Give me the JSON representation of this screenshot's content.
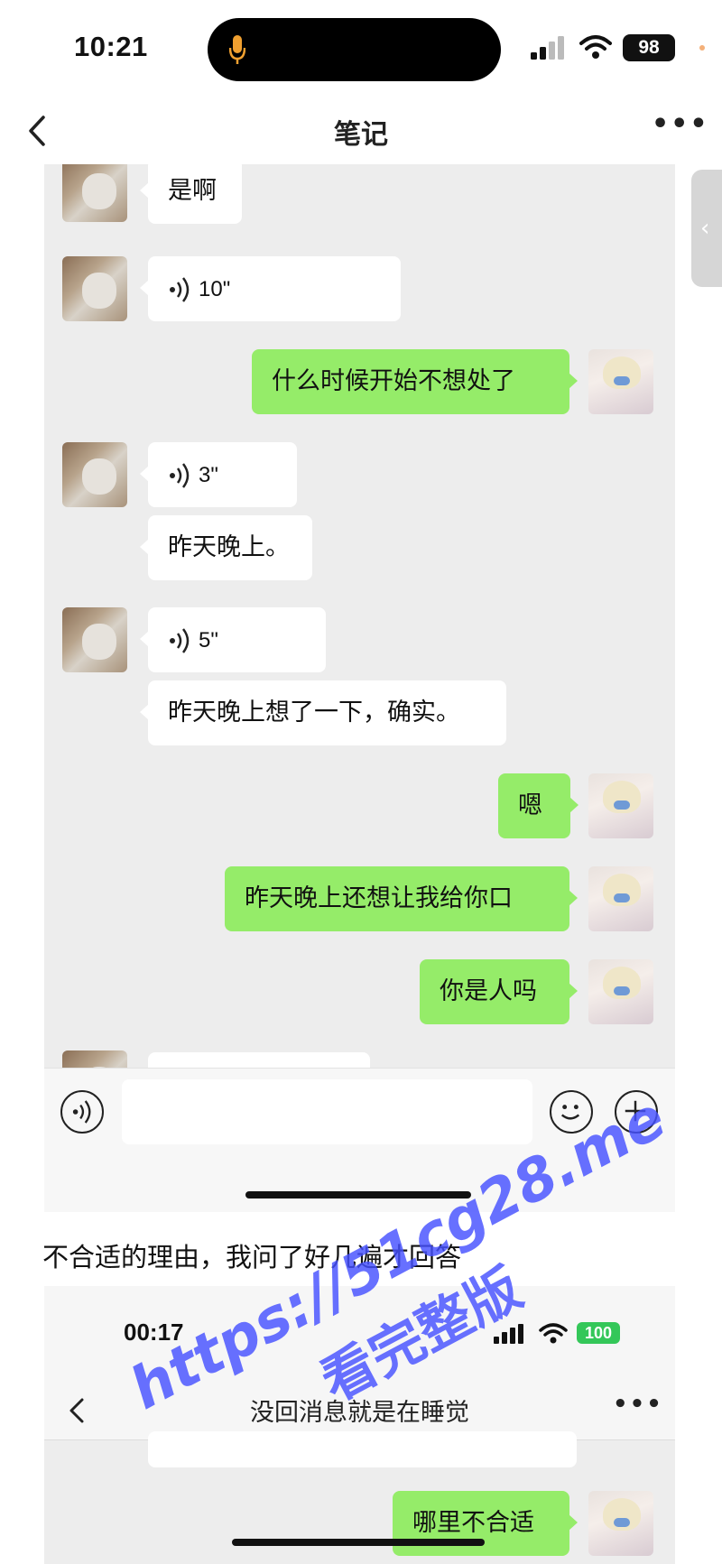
{
  "status_bar": {
    "time": "10:21",
    "battery": "98"
  },
  "header": {
    "title": "笔记"
  },
  "chat1": {
    "messages": [
      {
        "side": "left",
        "type": "text",
        "text": "是啊"
      },
      {
        "side": "left",
        "type": "voice",
        "duration": "10\""
      },
      {
        "side": "right",
        "type": "text",
        "text": "什么时候开始不想处了"
      },
      {
        "side": "left",
        "type": "voice",
        "duration": "3\""
      },
      {
        "side": "left",
        "type": "text",
        "text": "昨天晚上。"
      },
      {
        "side": "left",
        "type": "voice",
        "duration": "5\""
      },
      {
        "side": "left",
        "type": "text",
        "text": "昨天晚上想了一下，确实。"
      },
      {
        "side": "right",
        "type": "text",
        "text": "嗯"
      },
      {
        "side": "right",
        "type": "text",
        "text": "昨天晚上还想让我给你口"
      },
      {
        "side": "right",
        "type": "text",
        "text": "你是人吗"
      }
    ]
  },
  "caption": "不合适的理由，我问了好几遍才回答",
  "shot2": {
    "time": "00:17",
    "battery": "100",
    "title": "没回消息就是在睡觉",
    "messages": [
      {
        "side": "right",
        "type": "text",
        "text": "哪里不合适"
      }
    ]
  },
  "watermark": {
    "line1": "https://51cg28.me",
    "line2": "看完整版"
  },
  "icons": {
    "back": "chevron-left-icon",
    "more": "ellipsis-icon",
    "mic": "mic-icon",
    "voice": "voice-wave-icon",
    "emoji": "emoji-icon",
    "plus": "plus-icon"
  }
}
